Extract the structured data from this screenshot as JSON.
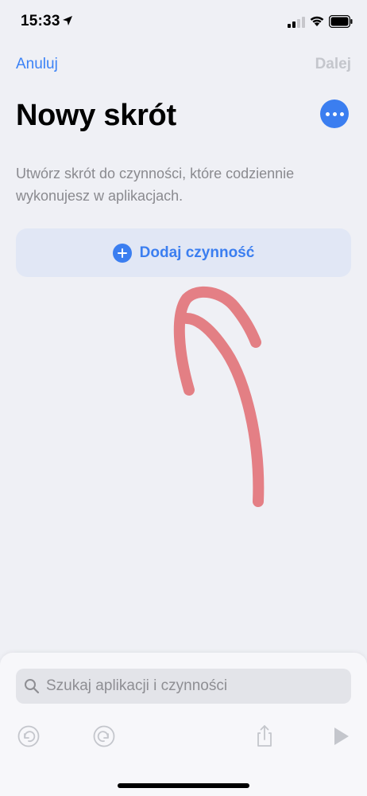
{
  "status_bar": {
    "time": "15:33",
    "icons": [
      "location-arrow-icon",
      "cellular-signal-icon",
      "wifi-icon",
      "battery-icon"
    ]
  },
  "nav": {
    "cancel_label": "Anuluj",
    "next_label": "Dalej"
  },
  "header": {
    "title": "Nowy skrót",
    "more_icon": "ellipsis-icon"
  },
  "description": "Utwórz skrót do czynności, które codziennie wykonujesz w aplikacjach.",
  "add_action": {
    "label": "Dodaj czynność",
    "icon": "plus-circle-icon"
  },
  "annotation": {
    "icon": "hand-drawn-arrow",
    "color": "#e05a5f"
  },
  "search": {
    "placeholder": "Szukaj aplikacji i czynności",
    "value": ""
  },
  "toolbar": {
    "icons": [
      "undo-icon",
      "redo-icon",
      "share-icon",
      "play-icon"
    ]
  },
  "colors": {
    "accent": "#3b7ef0",
    "background": "#eff0f5",
    "disabled": "#c4c6cc"
  }
}
